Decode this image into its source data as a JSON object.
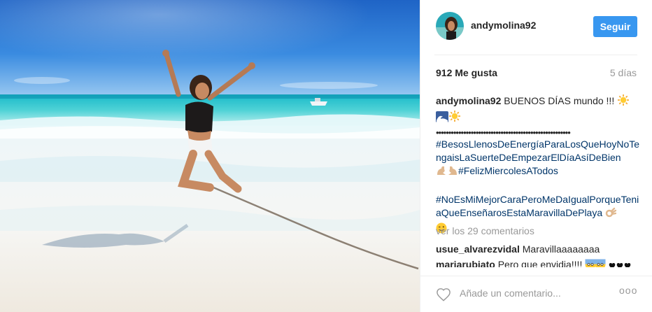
{
  "header": {
    "username": "andymolina92",
    "follow_label": "Seguir"
  },
  "stats": {
    "likes": "912 Me gusta",
    "time_ago": "5 días"
  },
  "caption": {
    "username": "andymolina92",
    "text": "BUENOS DÍAS mundo !!!",
    "dots": "••••••••••••••••••••••••••••••••••••••••••••••••••••••",
    "hashtag1": "#BesosLlenosDeEnergíaParaLosQueHoyNoTengaisLaSuerteDeEmpezarElDíaAsíDeBien",
    "hashtag2": "#FelizMiercolesATodos",
    "hashtag3": "#NoEsMiMejorCaraPeroMeDaIgualPorqueTeniaQueEnseñarosEstaMaravillaDePlaya"
  },
  "comments": {
    "view_all": "ver los 29 comentarios",
    "items": [
      {
        "user": "usue_alvarezvidal",
        "text": "Maravillaaaaaaaa"
      },
      {
        "user": "mariarubiato",
        "text": "Pero que envidia!!!!"
      }
    ]
  },
  "footer": {
    "add_comment_placeholder": "Añade un comentario...",
    "more_label": "ooo"
  },
  "colors": {
    "accent": "#3897f0",
    "hashtag": "#003569",
    "muted": "#999999"
  },
  "icons": [
    "heart-icon",
    "sun-emoji",
    "wave-emoji",
    "muscle-emoji",
    "wink-emoji",
    "ok-hand-emoji",
    "fearful-emoji",
    "black-heart-emoji"
  ]
}
